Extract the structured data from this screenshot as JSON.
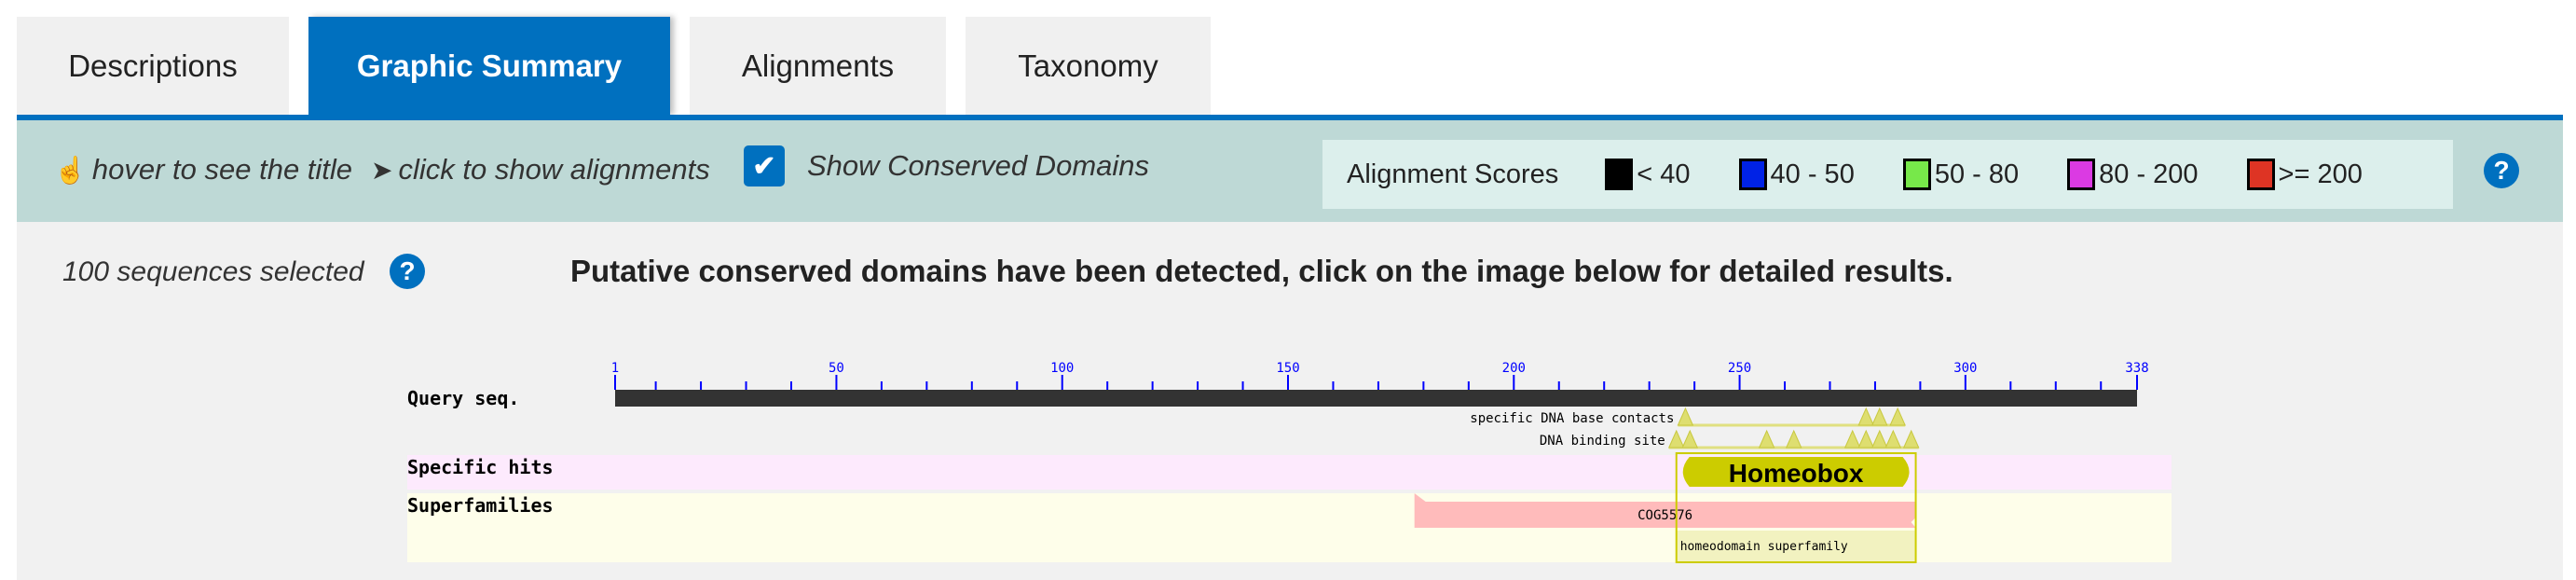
{
  "tabs": [
    {
      "label": "Descriptions",
      "active": false
    },
    {
      "label": "Graphic Summary",
      "active": true
    },
    {
      "label": "Alignments",
      "active": false
    },
    {
      "label": "Taxonomy",
      "active": false
    }
  ],
  "toolbar": {
    "hover_hint": "hover to see the title",
    "click_hint": "click to show alignments",
    "show_cd_label": "Show Conserved Domains",
    "show_cd_checked": true,
    "scores_title": "Alignment Scores",
    "scores": [
      {
        "label": "< 40",
        "color": "#000000"
      },
      {
        "label": "40 - 50",
        "color": "#0022e6"
      },
      {
        "label": "50 - 80",
        "color": "#77e84a"
      },
      {
        "label": "80 - 200",
        "color": "#db3ae3"
      },
      {
        "label": ">= 200",
        "color": "#de3424"
      }
    ],
    "help_icon": "question-circle-icon"
  },
  "content": {
    "selected": "100 sequences selected",
    "heading": "Putative conserved domains have been detected, click on the image below for detailed results."
  },
  "cd_graphic": {
    "query_label": "Query seq.",
    "specific_label": "Specific hits",
    "super_label": "Superfamilies",
    "length": 338,
    "tick_labels": [
      1,
      50,
      100,
      150,
      200,
      250,
      300,
      338
    ],
    "features": [
      {
        "label": "specific DNA base contacts",
        "start": 238,
        "end": 285,
        "sites": [
          238,
          278,
          281,
          285
        ]
      },
      {
        "label": "DNA binding site",
        "start": 236,
        "end": 288,
        "sites": [
          236,
          239,
          256,
          262,
          275,
          278,
          281,
          284,
          288
        ]
      }
    ],
    "specific_hits": [
      {
        "label": "Homeobox",
        "start": 236,
        "end": 289,
        "color": "#cccc00"
      }
    ],
    "superfamilies": [
      {
        "label": "COG5576",
        "start": 178,
        "end": 289,
        "color": "#ffbbbb"
      },
      {
        "label": "homeodomain superfamily",
        "start": 236,
        "end": 289,
        "color": "#f2f2c0"
      }
    ]
  }
}
